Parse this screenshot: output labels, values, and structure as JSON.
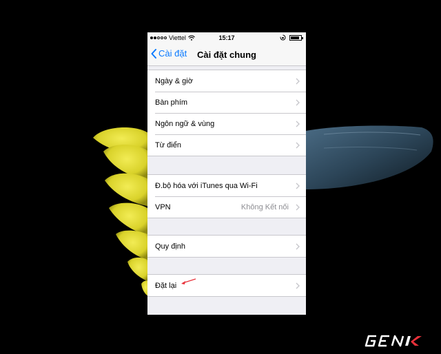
{
  "status_bar": {
    "carrier": "Viettel",
    "time": "15:17",
    "battery_level": 0.85
  },
  "nav": {
    "back_label": "Cài đặt",
    "title": "Cài đặt chung"
  },
  "groups": [
    {
      "rows": [
        {
          "label": "Ngày & giờ"
        },
        {
          "label": "Bàn phím"
        },
        {
          "label": "Ngôn ngữ & vùng"
        },
        {
          "label": "Từ điển"
        }
      ]
    },
    {
      "rows": [
        {
          "label": "Đ.bộ hóa với iTunes qua Wi-Fi"
        },
        {
          "label": "VPN",
          "detail": "Không Kết nối"
        }
      ]
    },
    {
      "rows": [
        {
          "label": "Quy định"
        }
      ]
    },
    {
      "rows": [
        {
          "label": "Đặt lại"
        }
      ]
    }
  ],
  "watermark": {
    "logo": "GENK"
  },
  "colors": {
    "accent": "#0a7aff",
    "annotation_arrow": "#e8313a",
    "background": "#efeff4",
    "flower": "#e6e03a"
  },
  "icons": [
    "wifi-icon",
    "lock-rotation-icon",
    "battery-icon",
    "chevron-left-icon",
    "chevron-right-icon"
  ]
}
